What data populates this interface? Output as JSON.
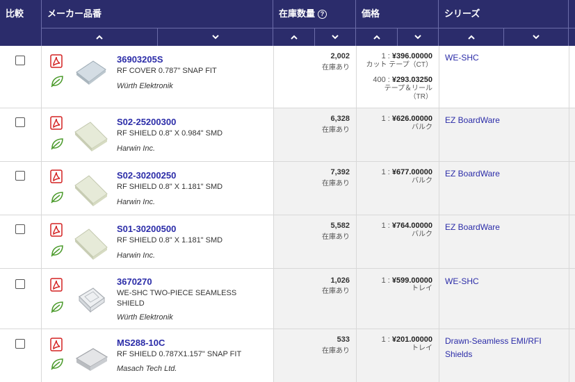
{
  "header": {
    "compare": "比較",
    "mfr_part": "メーカー品番",
    "stock": "在庫数量",
    "stock_help_icon": "?",
    "price": "価格",
    "series": "シリーズ"
  },
  "rows": [
    {
      "part_number": "36903205S",
      "description": "RF COVER 0.787\" SNAP FIT",
      "manufacturer": "Würth Elektronik",
      "quantity": "2,002",
      "quantity_status": "在庫あり",
      "price1": "1 : ",
      "price1_value": "¥396.00000",
      "price1_pack": "カット テープ（CT）",
      "price2": "400 : ",
      "price2_value": "¥293.03250",
      "price2_pack_a": "テープ＆リール",
      "price2_pack_b": "（TR）",
      "series": "WE-SHC"
    },
    {
      "part_number": "S02-25200300",
      "description": "RF SHIELD 0.8\" X 0.984\" SMD",
      "manufacturer": "Harwin Inc.",
      "quantity": "6,328",
      "quantity_status": "在庫あり",
      "price1": "1 : ",
      "price1_value": "¥626.00000",
      "price1_pack": "バルク",
      "series": "EZ BoardWare"
    },
    {
      "part_number": "S02-30200250",
      "description": "RF SHIELD 0.8\" X 1.181\" SMD",
      "manufacturer": "Harwin Inc.",
      "quantity": "7,392",
      "quantity_status": "在庫あり",
      "price1": "1 : ",
      "price1_value": "¥677.00000",
      "price1_pack": "バルク",
      "series": "EZ BoardWare"
    },
    {
      "part_number": "S01-30200500",
      "description": "RF SHIELD 0.8\" X 1.181\" SMD",
      "manufacturer": "Harwin Inc.",
      "quantity": "5,582",
      "quantity_status": "在庫あり",
      "price1": "1 : ",
      "price1_value": "¥764.00000",
      "price1_pack": "バルク",
      "series": "EZ BoardWare"
    },
    {
      "part_number": "3670270",
      "description": "WE-SHC TWO-PIECE SEAMLESS SHIELD",
      "manufacturer": "Würth Elektronik",
      "quantity": "1,026",
      "quantity_status": "在庫あり",
      "price1": "1 : ",
      "price1_value": "¥599.00000",
      "price1_pack": "トレイ",
      "series": "WE-SHC"
    },
    {
      "part_number": "MS288-10C",
      "description": "RF SHIELD 0.787X1.157\" SNAP FIT",
      "manufacturer": "Masach Tech Ltd.",
      "quantity": "533",
      "quantity_status": "在庫あり",
      "price1": "1 : ",
      "price1_value": "¥201.00000",
      "price1_pack": "トレイ",
      "series": "Drawn-Seamless EMI/RFI Shields"
    }
  ],
  "icons": {
    "pdf": "datasheet-pdf-icon",
    "leaf": "rohs-leaf-icon",
    "sort_up": "sort-ascending-icon",
    "sort_down": "sort-descending-icon"
  },
  "colors": {
    "header_bg": "#2b2c6b",
    "link": "#2b2ca8",
    "pdf_red": "#d32020",
    "leaf_green": "#4a9a2a"
  }
}
